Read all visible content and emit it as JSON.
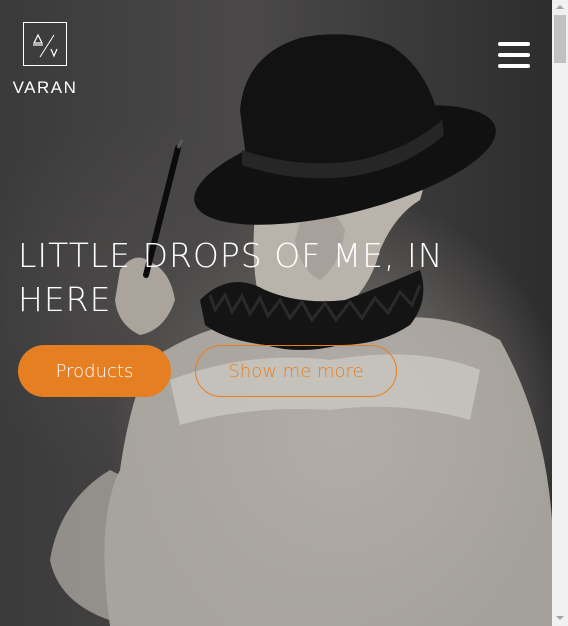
{
  "brand": {
    "logo_mark": "A/V",
    "name": "VARAN"
  },
  "nav": {
    "menu_icon": "hamburger-menu-icon"
  },
  "hero": {
    "headline": "LITTLE DROPS OF ME, IN HERE",
    "image_description": "woman in black bowler hat holding paintbrush"
  },
  "buttons": {
    "primary_label": "Products",
    "secondary_label": "Show me more"
  },
  "colors": {
    "accent": "#e67f22",
    "overlay": "#3b3a3a",
    "text": "#ffffff"
  }
}
